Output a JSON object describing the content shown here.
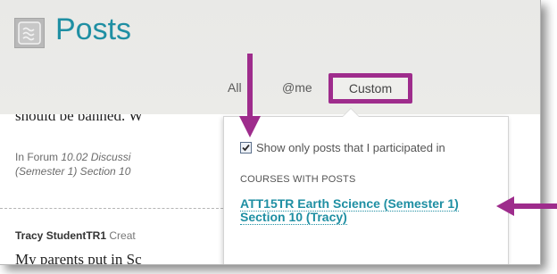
{
  "header": {
    "title": "Posts",
    "icon": "posts-icon"
  },
  "tabs": {
    "all": "All",
    "me": "@me",
    "custom": "Custom"
  },
  "posts": {
    "snippet_1": "should be banned. W",
    "forum_prefix": "In Forum ",
    "forum_name": "10.02 Discussi",
    "forum_course": "(Semester 1) Section 10",
    "author": "Tracy StudentTR1",
    "action": " Creat",
    "snippet_2": "My parents put in Sc"
  },
  "popover": {
    "filter_label": "Show only posts that I participated in",
    "filter_checked": true,
    "section_label": "COURSES WITH POSTS",
    "course_link": "ATT15TR Earth Science (Semester 1) Section 10 (Tracy)"
  },
  "colors": {
    "accent": "#1f8fa3",
    "highlight": "#9e2c8c",
    "header_bg": "#e9e9e7"
  }
}
